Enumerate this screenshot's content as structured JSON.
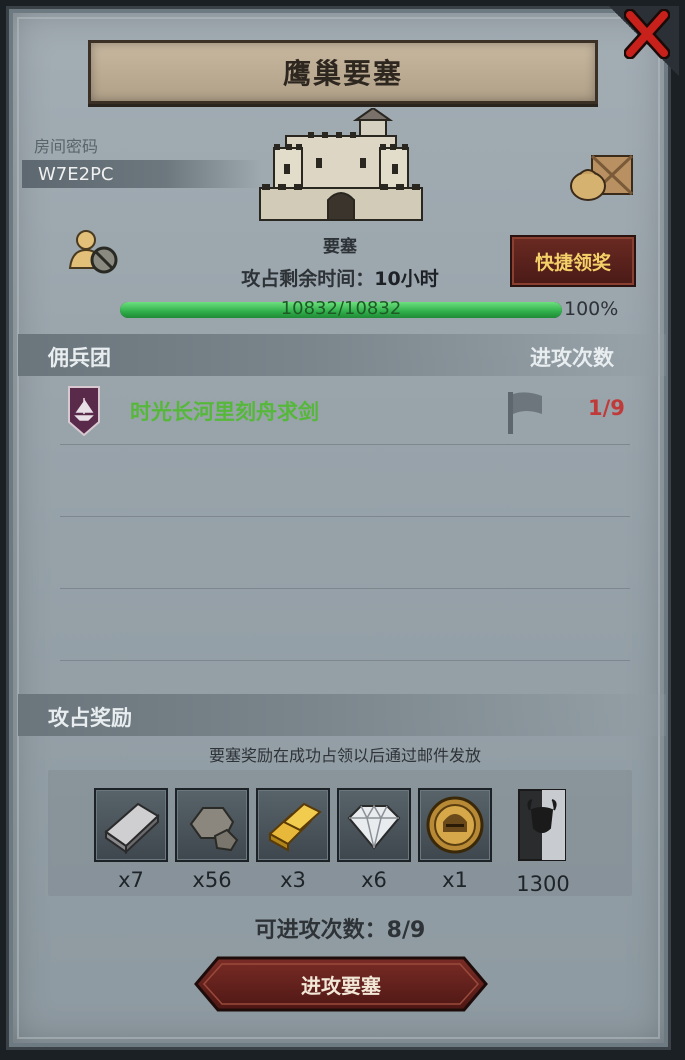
{
  "title": "鹰巢要塞",
  "room": {
    "label": "房间密码",
    "code": "W7E2PC"
  },
  "fortress": {
    "name": "要塞"
  },
  "quick_claim_label": "快捷领奖",
  "occupy_time": {
    "label": "攻占剩余时间：",
    "value": "10小时"
  },
  "hp": {
    "text": "10832/10832",
    "percent_text": "100%",
    "fraction": 1.0
  },
  "mercenary_section": {
    "title": "佣兵团",
    "attacks_header": "进攻次数"
  },
  "mercenaries": [
    {
      "name": "时光长河里刻舟求剑",
      "attacks": "1/9"
    }
  ],
  "reward_section": {
    "title": "攻占奖励",
    "note": "要塞奖励在成功占领以后通过邮件发放"
  },
  "rewards": [
    {
      "icon": "iron-ingot-icon",
      "count": "x7"
    },
    {
      "icon": "stone-icon",
      "count": "x56"
    },
    {
      "icon": "gold-bar-icon",
      "count": "x3"
    },
    {
      "icon": "diamond-icon",
      "count": "x6"
    },
    {
      "icon": "helmet-medal-icon",
      "count": "x1"
    },
    {
      "icon": "bull-banner-icon",
      "count": "1300"
    }
  ],
  "remaining_attacks": {
    "label": "可进攻次数：",
    "value": "8/9"
  },
  "attack_button_label": "进攻要塞",
  "colors": {
    "guild_name": "#56b83a",
    "attack_count": "#c03a3a",
    "quick_btn_text": "#f3d068",
    "hp_bar": "#2fae4a"
  }
}
